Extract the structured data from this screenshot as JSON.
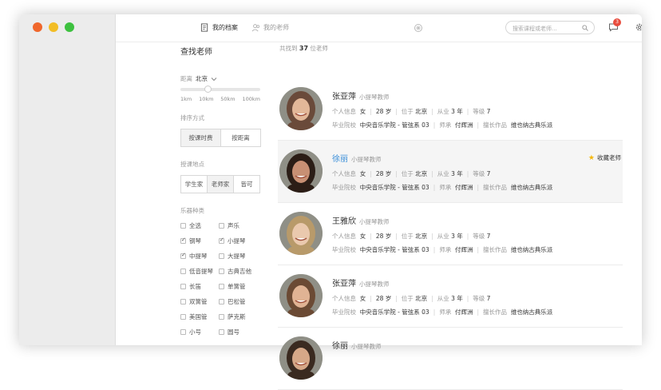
{
  "nav": {
    "tabs": [
      {
        "label": "我的档案",
        "active": true
      },
      {
        "label": "我的老师",
        "active": false
      }
    ],
    "search_placeholder": "搜索课程或老师...",
    "message_badge": "3"
  },
  "filters": {
    "title": "查找老师",
    "distance_label": "距离",
    "distance_value": "北京",
    "distance_ticks": [
      "1km",
      "10km",
      "50km",
      "100km"
    ],
    "distance_slider_level": 0.33,
    "sort_label": "排序方式",
    "sort_options": [
      "按课时费",
      "按距离"
    ],
    "place_label": "授课地点",
    "place_options": [
      "学生家",
      "老师家",
      "皆可"
    ],
    "instrument_label": "乐器种类",
    "instruments": [
      {
        "label": "全选",
        "checked": false
      },
      {
        "label": "声乐",
        "checked": false
      },
      {
        "label": "钢琴",
        "checked": true
      },
      {
        "label": "小提琴",
        "checked": true
      },
      {
        "label": "中提琴",
        "checked": true
      },
      {
        "label": "大提琴",
        "checked": false
      },
      {
        "label": "低音提琴",
        "checked": false
      },
      {
        "label": "古典吉他",
        "checked": false
      },
      {
        "label": "长笛",
        "checked": false
      },
      {
        "label": "单簧管",
        "checked": false
      },
      {
        "label": "双簧管",
        "checked": false
      },
      {
        "label": "巴松管",
        "checked": false
      },
      {
        "label": "美国管",
        "checked": false
      },
      {
        "label": "萨克斯",
        "checked": false
      },
      {
        "label": "小号",
        "checked": false
      },
      {
        "label": "圆号",
        "checked": false
      }
    ]
  },
  "results": {
    "count_prefix": "共找到",
    "count": "37",
    "count_suffix": "位老师",
    "labels": {
      "info": "个人信息",
      "location_prefix": "位于",
      "exp_prefix": "从业",
      "level_prefix": "等级",
      "school": "毕业院校",
      "mentor": "师承",
      "works": "擅长作品",
      "favorite": "收藏老师"
    },
    "teachers": [
      {
        "name": "张亚萍",
        "title": "小提琴教师",
        "gender": "女",
        "age": "28 岁",
        "city": "北京",
        "years": "3 年",
        "level": "7",
        "school": "中央音乐学院 - 管弦系 03",
        "mentor": "付辉洲",
        "works": "维也纳古典乐派",
        "highlight": false
      },
      {
        "name": "徐丽",
        "title": "小提琴教师",
        "gender": "女",
        "age": "28 岁",
        "city": "北京",
        "years": "3 年",
        "level": "7",
        "school": "中央音乐学院 - 管弦系 03",
        "mentor": "付辉洲",
        "works": "维也纳古典乐派",
        "highlight": true
      },
      {
        "name": "王雅欣",
        "title": "小提琴教师",
        "gender": "女",
        "age": "28 岁",
        "city": "北京",
        "years": "3 年",
        "level": "7",
        "school": "中央音乐学院 - 管弦系 03",
        "mentor": "付辉洲",
        "works": "维也纳古典乐派",
        "highlight": false
      },
      {
        "name": "张亚萍",
        "title": "小提琴教师",
        "gender": "女",
        "age": "28 岁",
        "city": "北京",
        "years": "3 年",
        "level": "7",
        "school": "中央音乐学院 - 管弦系 03",
        "mentor": "付辉洲",
        "works": "维也纳古典乐派",
        "highlight": false
      },
      {
        "name": "徐丽",
        "title": "小提琴教师",
        "partial": true,
        "highlight": false
      }
    ]
  },
  "colors": {
    "accent": "#3b8fd9",
    "star": "#f5b70c",
    "badge": "#e84c3d"
  },
  "icons": [
    "profile-icon",
    "teacher-icon",
    "app-logo-icon",
    "search-icon",
    "message-icon",
    "gear-icon",
    "star-icon",
    "chevron-down-icon"
  ]
}
